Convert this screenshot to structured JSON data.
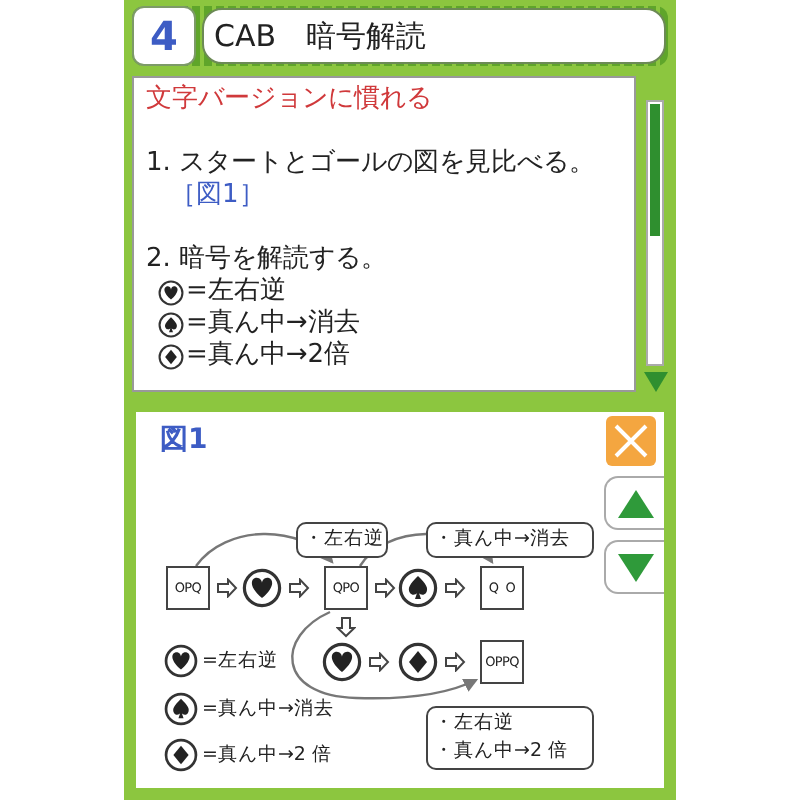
{
  "header": {
    "number": "4",
    "title": "CAB　暗号解読"
  },
  "instructions": {
    "heading": "文字バージョンに慣れる",
    "steps": [
      {
        "text": "1. スタートとゴールの図を見比べる。",
        "link": "［図1］"
      },
      {
        "text": "2. 暗号を解読する。"
      }
    ],
    "legend": [
      {
        "kind": "heart",
        "meaning": "=左右逆"
      },
      {
        "kind": "spade",
        "meaning": "=真ん中→消去"
      },
      {
        "kind": "diamond",
        "meaning": "=真ん中→2倍"
      }
    ]
  },
  "figure": {
    "title": "図1",
    "row_1": [
      {
        "kind": "box",
        "text": "OPQ"
      },
      {
        "kind": "heart"
      },
      {
        "kind": "box",
        "text": "QPO"
      },
      {
        "kind": "spade"
      },
      {
        "kind": "box",
        "text": "Q  O"
      }
    ],
    "row_2": [
      {
        "kind": "heart"
      },
      {
        "kind": "diamond"
      },
      {
        "kind": "box",
        "text": "OPPQ"
      }
    ],
    "callouts": [
      {
        "lines": [
          "・左右逆"
        ]
      },
      {
        "lines": [
          "・真ん中→消去"
        ]
      },
      {
        "lines": [
          "・左右逆",
          "・真ん中→2 倍"
        ]
      }
    ],
    "legend": [
      {
        "kind": "heart",
        "meaning": "=左右逆"
      },
      {
        "kind": "spade",
        "meaning": "=真ん中→消去"
      },
      {
        "kind": "diamond",
        "meaning": "=真ん中→2 倍"
      }
    ]
  }
}
